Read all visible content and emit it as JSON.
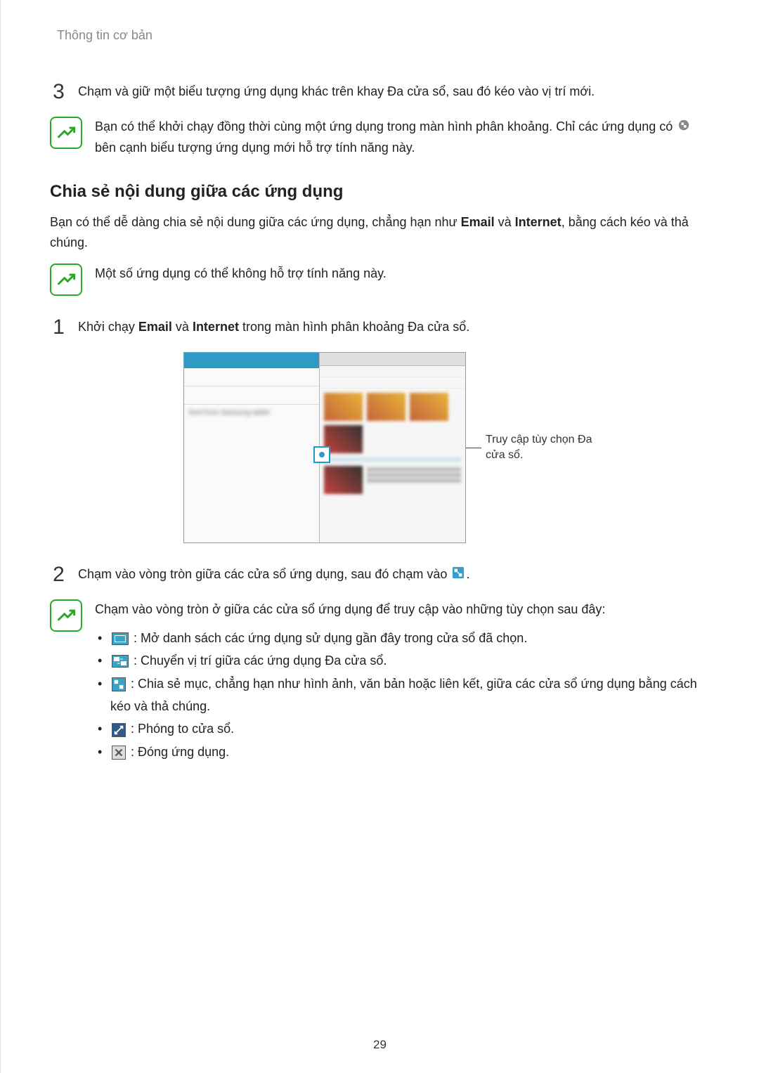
{
  "header": "Thông tin cơ bản",
  "step3": {
    "num": "3",
    "text": "Chạm và giữ một biểu tượng ứng dụng khác trên khay Đa cửa sổ, sau đó kéo vào vị trí mới."
  },
  "note1": {
    "part1": "Bạn có thể khởi chạy đồng thời cùng một ứng dụng trong màn hình phân khoảng. Chỉ các ứng dụng có",
    "part2": "bên cạnh biểu tượng ứng dụng mới hỗ trợ tính năng này."
  },
  "section_heading": "Chia sẻ nội dung giữa các ứng dụng",
  "intro": {
    "part1": "Bạn có thể dễ dàng chia sẻ nội dung giữa các ứng dụng, chẳng hạn như",
    "bold1": "Email",
    "mid1": "và",
    "bold2": "Internet",
    "part2": ", bằng cách kéo và thả chúng."
  },
  "note2": "Một số ứng dụng có thể không hỗ trợ tính năng này.",
  "step1": {
    "num": "1",
    "pre": "Khởi chạy",
    "bold1": "Email",
    "mid": "và",
    "bold2": "Internet",
    "post": "trong màn hình phân khoảng Đa cửa sổ."
  },
  "callout_label": "Truy cập tùy chọn Đa cửa sổ.",
  "step2": {
    "num": "2",
    "text": "Chạm vào vòng tròn giữa các cửa sổ ứng dụng, sau đó chạm vào"
  },
  "note3": {
    "intro": "Chạm vào vòng tròn ở giữa các cửa sổ ứng dụng để truy cập vào những tùy chọn sau đây:",
    "bullets": [
      ": Mở danh sách các ứng dụng sử dụng gần đây trong cửa sổ đã chọn.",
      ": Chuyển vị trí giữa các ứng dụng Đa cửa sổ.",
      ": Chia sẻ mục, chẳng hạn như hình ảnh, văn bản hoặc liên kết, giữa các cửa sổ ứng dụng bằng cách kéo và thả chúng.",
      ": Phóng to cửa sổ.",
      ": Đóng ứng dụng."
    ]
  },
  "page_number": "29"
}
